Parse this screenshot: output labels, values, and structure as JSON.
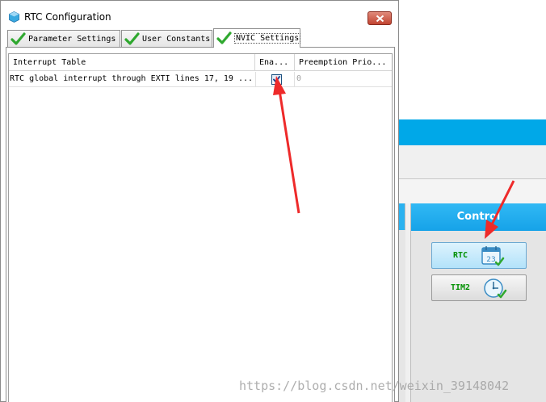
{
  "dialog": {
    "title": "RTC Configuration",
    "tabs": [
      {
        "label": "Parameter Settings",
        "active": false
      },
      {
        "label": "User Constants",
        "active": false
      },
      {
        "label": "NVIC Settings",
        "active": true
      }
    ],
    "table": {
      "columns": [
        "Interrupt Table",
        "Ena...",
        "Preemption Prio..."
      ],
      "rows": [
        {
          "interrupt": "RTC global interrupt through EXTI lines 17, 19 ...",
          "enabled": true,
          "preemption_priority": "0"
        }
      ]
    }
  },
  "background_panel": {
    "header": "Control",
    "buttons": [
      {
        "label": "RTC",
        "icon": "calendar-icon",
        "calendar_day": "23",
        "selected": true
      },
      {
        "label": "TIM2",
        "icon": "clock-icon",
        "selected": false
      }
    ]
  },
  "watermark": "https://blog.csdn.net/weixin_39148042",
  "colors": {
    "accent_blue": "#00a8e8",
    "check_green": "#2fa82f",
    "annotation_red": "#ee2a2a",
    "close_red": "#c24532"
  }
}
